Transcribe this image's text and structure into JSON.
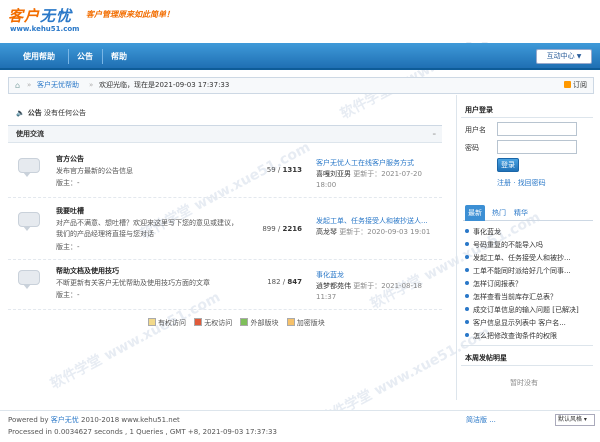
{
  "header": {
    "logo_text_a": "客户",
    "logo_text_b": "无忧",
    "logo_url": "www.kehu51.com",
    "tagline": "客户管理原来如此简单！"
  },
  "nav": {
    "items": [
      {
        "label": "使用帮助"
      },
      {
        "label": "公告"
      },
      {
        "label": "帮助"
      }
    ],
    "right_button": "互动中心"
  },
  "breadcrumb": {
    "forum": "客户无忧帮助",
    "welcome": "欢迎光临，现在是2021-09-03 17:37:33",
    "rss": "订阅"
  },
  "announcement": {
    "label": "公告",
    "text": "没有任何公告"
  },
  "forum": {
    "section": "使用交流",
    "collapse": "–",
    "rows": [
      {
        "name": "官方公告",
        "desc": "发布官方最新的公告信息",
        "mod": "版主：-",
        "topics": "59",
        "posts": "1313",
        "last_title": "客户无忧人工在线客户服务方式",
        "last_user": "喜嘎刘亚男",
        "last_time": "更新于：2021-07-20 18:00"
      },
      {
        "name": "我要吐槽",
        "desc": "对产品不满意、想吐槽？欢迎来这里写下您的意见或建议，我们的产品经理将直接与您对话",
        "mod": "版主：-",
        "topics": "899",
        "posts": "2216",
        "last_title": "发起工单、任务接受人和被抄送人...",
        "last_user": "高龙琴",
        "last_time": "更新于：2020-09-03 19:01"
      },
      {
        "name": "帮助文档及使用技巧",
        "desc": "不断更新有关客户无忧帮助及使用技巧方面的文章",
        "mod": "版主：-",
        "topics": "182",
        "posts": "847",
        "last_title": "事化蓝龙",
        "last_user": "逍梦都苑伟",
        "last_time": "更新于：2021-08-18 11:37"
      }
    ]
  },
  "legend": {
    "items": [
      {
        "label": "有权访问",
        "color": "#f2d98a"
      },
      {
        "label": "无权访问",
        "color": "#e05a3a"
      },
      {
        "label": "外部版块",
        "color": "#7fbf5a"
      },
      {
        "label": "加密版块",
        "color": "#f6c16a"
      }
    ]
  },
  "sidebar": {
    "login_title": "用户登录",
    "user_label": "用户名",
    "pass_label": "密码",
    "login_button": "登录",
    "register": "注册",
    "sep": " · ",
    "find_pass": "找回密码",
    "tabs": [
      {
        "label": "最新"
      },
      {
        "label": "热门"
      },
      {
        "label": "精华"
      }
    ],
    "threads": [
      "事化蓝龙",
      "号码重复的不能导入吗",
      "发起工单、任务接受人和被抄...",
      "工单不能同时派给好几个同事...",
      "怎样订阅报表？",
      "怎样查看当前库存汇总表？",
      "成交订单信息的输入问题 [已解决]",
      "客户信息显示列表中 客户名...",
      "怎么把修改查询条件的权限"
    ],
    "weekly_title": "本周发帖明星",
    "weekly_empty": "暂时没有"
  },
  "footer": {
    "powered": "Powered by ",
    "brand": "客户无忧",
    "years": " 2010-2018 www.kehu51.net",
    "processed": "Processed in 0.0034627 seconds , 1 Queries , GMT +8, 2021-09-03 17:37:33",
    "links": "简洁版 ...",
    "style_select": "默认风格"
  },
  "watermark": "软件学堂 www.xue51.com"
}
